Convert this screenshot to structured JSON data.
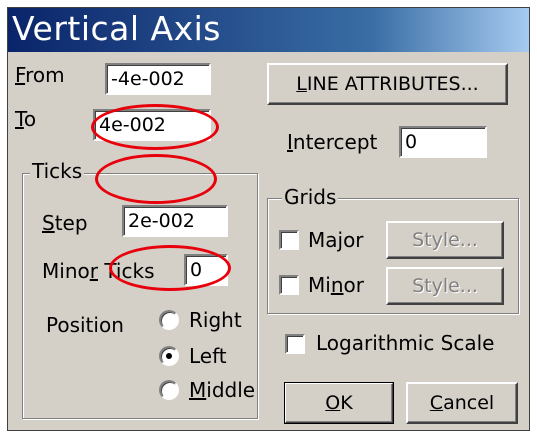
{
  "window": {
    "title": "Vertical Axis"
  },
  "range": {
    "from_label": "From",
    "from_value": "-4e-002",
    "to_label": "To",
    "to_value": "4e-002"
  },
  "ticks": {
    "group_label": "Ticks",
    "step_label": "Step",
    "step_value": "2e-002",
    "minor_label": "Minor Ticks",
    "minor_value": "0",
    "position_label": "Position",
    "options": [
      "Right",
      "Left",
      "Middle"
    ],
    "selected": "Left"
  },
  "line_attributes_label": "LINE ATTRIBUTES...",
  "intercept": {
    "label": "Intercept",
    "value": "0"
  },
  "grids": {
    "group_label": "Grids",
    "major_label": "Major",
    "major_checked": false,
    "minor_label": "Minor",
    "minor_checked": false,
    "style_label": "Style..."
  },
  "logarithmic": {
    "label": "Logarithmic Scale",
    "checked": false
  },
  "buttons": {
    "ok": "OK",
    "cancel": "Cancel"
  },
  "colors": {
    "face": "#d4d0c8",
    "title_start": "#0a246a",
    "title_end": "#a6caf0",
    "annotation": "#e8000b"
  }
}
